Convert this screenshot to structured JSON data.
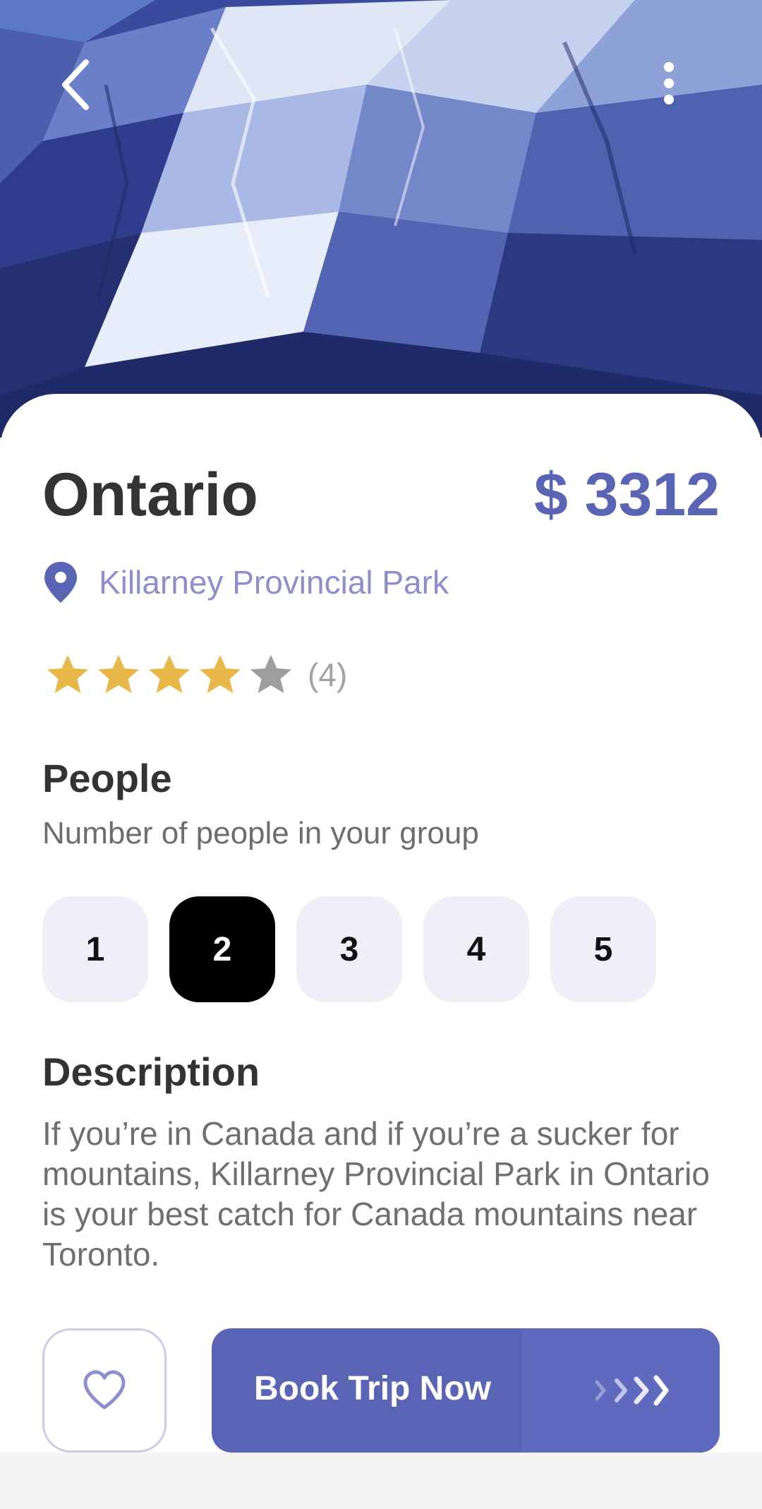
{
  "header": {
    "back_icon": "chevron-left-icon",
    "more_icon": "more-vertical-icon"
  },
  "destination": {
    "title": "Ontario",
    "price": "$ 3312",
    "location_icon": "map-pin-icon",
    "location": "Killarney Provincial Park",
    "rating": 4,
    "rating_max": 5,
    "rating_count": "(4)"
  },
  "people": {
    "heading": "People",
    "subheading": "Number of people in your group",
    "options": [
      "1",
      "2",
      "3",
      "4",
      "5"
    ],
    "selected": "2"
  },
  "description": {
    "heading": "Description",
    "text": "If you’re in Canada and if you’re a sucker for mountains, Killarney Provincial Park in Ontario is your best catch for Canada mountains near Toronto."
  },
  "actions": {
    "favorite_icon": "heart-icon",
    "book_label": "Book Trip Now",
    "book_arrow_icon": "chevrons-right-icon"
  },
  "colors": {
    "accent": "#5a64b5",
    "location_text": "#8c8fcc",
    "star_filled": "#e8b84a",
    "star_empty": "#9e9e9e",
    "selected_chip": "#000000",
    "chip_bg": "#eff0f7"
  }
}
